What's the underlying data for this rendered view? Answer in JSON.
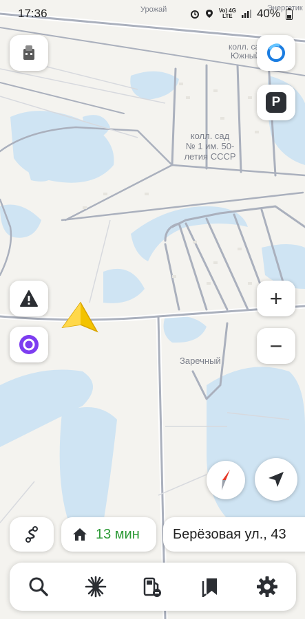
{
  "status": {
    "time": "17:36",
    "battery": "40%",
    "net_top": "Vo) 4G",
    "net_bottom": "LTE"
  },
  "map": {
    "labels": {
      "urozhai": "Урожай",
      "energetik": "Энергетик",
      "south_sad": "колл. са",
      "south": "Южный",
      "sad_line1": "колл. сад",
      "sad_line2": "№ 1 им. 50-",
      "sad_line3": "летия СССР",
      "zarechny": "Заречный"
    }
  },
  "controls": {
    "parking": "P",
    "zoom_in": "+",
    "zoom_out": "−"
  },
  "route": {
    "time": "13 мин",
    "time_color": "#2c9a36",
    "destination": "Берёзовая ул., 43"
  },
  "icons": [
    "profile-avatar-icon",
    "alice-icon",
    "parking-icon",
    "warning-icon",
    "alice-assistant-icon",
    "zoom-in-icon",
    "zoom-out-icon",
    "compass-icon",
    "location-arrow-icon",
    "route-icon",
    "home-icon",
    "search-icon",
    "discovery-icon",
    "fuel-icon",
    "bookmarks-icon",
    "settings-icon"
  ]
}
